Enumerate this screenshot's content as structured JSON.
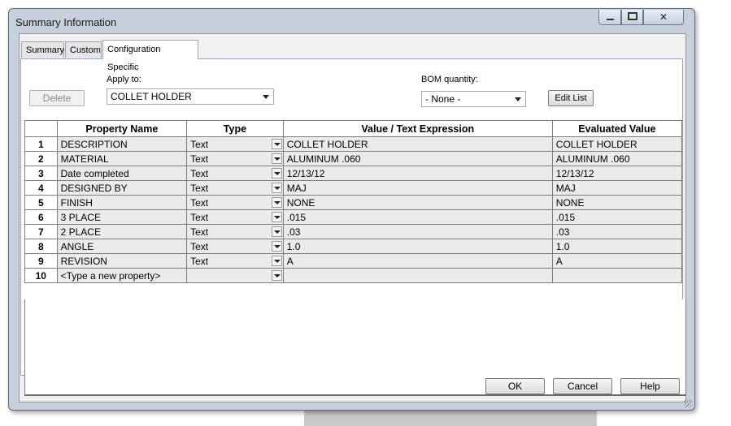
{
  "window": {
    "title": "Summary Information"
  },
  "controls": {
    "minimize": "minimize-icon",
    "maximize": "maximize-icon",
    "close": "✕"
  },
  "tabs": [
    {
      "label": "Summary",
      "active": false
    },
    {
      "label": "Custom",
      "active": false
    },
    {
      "label": "Configuration Specific",
      "active": true
    }
  ],
  "form": {
    "delete_label": "Delete",
    "apply_to_label": "Apply to:",
    "apply_to_value": "COLLET HOLDER",
    "bom_label": "BOM quantity:",
    "bom_value": "- None -",
    "edit_list_label": "Edit List"
  },
  "table": {
    "columns": [
      "",
      "Property Name",
      "Type",
      "Value / Text Expression",
      "Evaluated Value"
    ],
    "rows": [
      {
        "num": "1",
        "name": "DESCRIPTION",
        "type": "Text",
        "value": "COLLET HOLDER",
        "evaluated": "COLLET HOLDER"
      },
      {
        "num": "2",
        "name": "MATERIAL",
        "type": "Text",
        "value": "ALUMINUM .060",
        "evaluated": "ALUMINUM .060"
      },
      {
        "num": "3",
        "name": "Date completed",
        "type": "Text",
        "value": "12/13/12",
        "evaluated": "12/13/12"
      },
      {
        "num": "4",
        "name": "DESIGNED BY",
        "type": "Text",
        "value": "MAJ",
        "evaluated": "MAJ"
      },
      {
        "num": "5",
        "name": "FINISH",
        "type": "Text",
        "value": "NONE",
        "evaluated": "NONE"
      },
      {
        "num": "6",
        "name": "3 PLACE",
        "type": "Text",
        "value": ".015",
        "evaluated": ".015"
      },
      {
        "num": "7",
        "name": "2 PLACE",
        "type": "Text",
        "value": ".03",
        "evaluated": ".03"
      },
      {
        "num": "8",
        "name": "ANGLE",
        "type": "Text",
        "value": "1.0",
        "evaluated": "1.0"
      },
      {
        "num": "9",
        "name": "REVISION",
        "type": "Text",
        "value": "A",
        "evaluated": "A"
      },
      {
        "num": "10",
        "name": "<Type a new property>",
        "type": "",
        "value": "",
        "evaluated": ""
      }
    ]
  },
  "footer": {
    "ok_label": "OK",
    "cancel_label": "Cancel",
    "help_label": "Help"
  }
}
